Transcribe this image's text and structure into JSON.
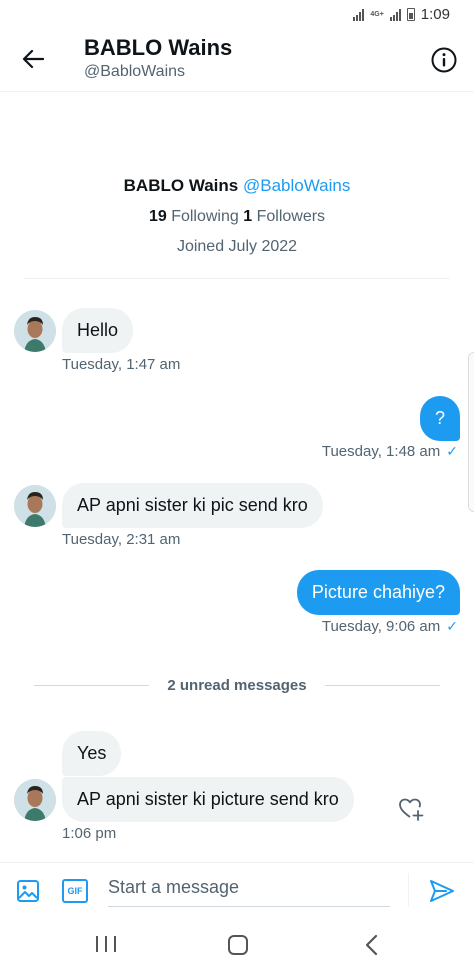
{
  "status_bar": {
    "time": "1:09",
    "network": "4G+"
  },
  "header": {
    "name": "BABLO Wains",
    "handle": "@BabloWains"
  },
  "profile": {
    "name": "BABLO Wains",
    "handle": "@BabloWains",
    "following_count": "19",
    "following_label": "Following",
    "followers_count": "1",
    "followers_label": "Followers",
    "joined": "Joined July 2022"
  },
  "messages": [
    {
      "from": "them",
      "text": "Hello",
      "time": "Tuesday, 1:47 am"
    },
    {
      "from": "me",
      "text": "?",
      "time": "Tuesday, 1:48 am",
      "seen": true
    },
    {
      "from": "them",
      "text": "AP apni sister ki pic send kro",
      "time": "Tuesday, 2:31 am"
    },
    {
      "from": "me",
      "text": "Picture chahiye?",
      "time": "Tuesday, 9:06 am",
      "seen": true
    },
    {
      "from": "them",
      "text": "Yes"
    },
    {
      "from": "them",
      "text": "AP apni sister ki picture send kro",
      "time": "1:06 pm"
    }
  ],
  "unread_divider": "2 unread messages",
  "composer": {
    "placeholder": "Start a message",
    "gif_label": "GIF"
  },
  "colors": {
    "accent": "#1d9bf0",
    "incoming_bubble": "#eff3f4",
    "secondary_text": "#536471"
  },
  "icons": {
    "back": "arrow-left-icon",
    "info": "info-icon",
    "react": "heart-plus-icon",
    "image": "image-icon",
    "gif": "gif-icon",
    "send": "send-icon",
    "nav": [
      "recent-apps-icon",
      "home-icon",
      "back-chevron-icon"
    ]
  }
}
